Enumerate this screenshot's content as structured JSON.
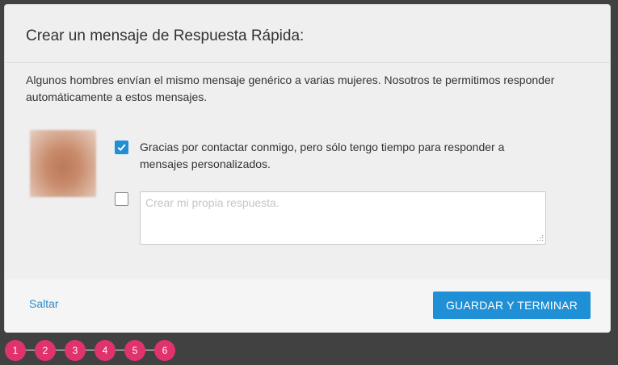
{
  "dialog": {
    "title": "Crear un mensaje de Respuesta Rápida:",
    "description": "Algunos hombres envían el mismo mensaje genérico a varias mujeres. Nosotros te permitimos responder automáticamente a estos mensajes.",
    "option_default": {
      "checked": true,
      "label": "Gracias por contactar conmigo, pero sólo tengo tiempo para responder a mensajes personalizados."
    },
    "option_custom": {
      "checked": false,
      "placeholder": "Crear mi propia respuesta."
    }
  },
  "footer": {
    "skip_label": "Saltar",
    "save_label": "GUARDAR Y TERMINAR"
  },
  "steps": [
    "1",
    "2",
    "3",
    "4",
    "5",
    "6"
  ],
  "colors": {
    "accent": "#1f8fd6",
    "step": "#e0336e",
    "link": "#2b8bc5",
    "backdrop": "#414141"
  }
}
